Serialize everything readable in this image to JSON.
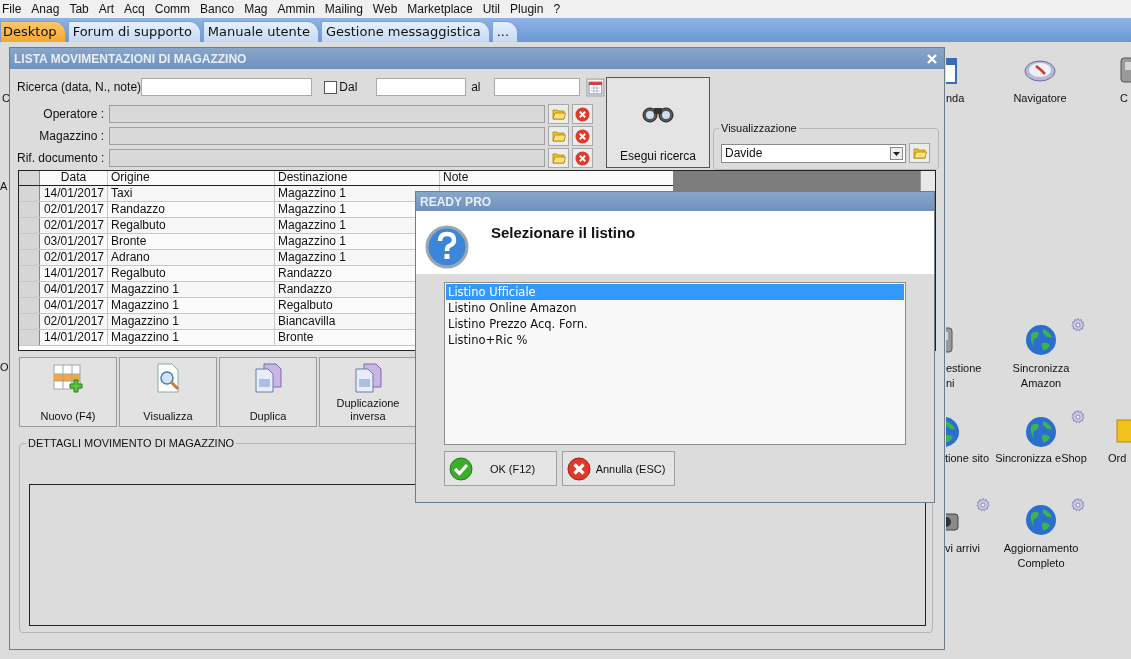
{
  "menu": [
    "File",
    "Anag",
    "Tab",
    "Art",
    "Acq",
    "Comm",
    "Banco",
    "Mag",
    "Ammin",
    "Mailing",
    "Web",
    "Marketplace",
    "Util",
    "Plugin",
    "?"
  ],
  "tabs": [
    {
      "label": "Desktop",
      "selected": true
    },
    {
      "label": "Forum di supporto",
      "selected": false
    },
    {
      "label": "Manuale utente",
      "selected": false
    },
    {
      "label": "Gestione messaggistica",
      "selected": false
    },
    {
      "label": "...",
      "selected": false
    }
  ],
  "desktop_icons": [
    {
      "lines": [
        "C"
      ],
      "kind": "none",
      "gear": false
    },
    {
      "lines": [
        "nda"
      ],
      "kind": "calendar",
      "gear": false
    },
    {
      "lines": [
        "Navigatore"
      ],
      "kind": "compass",
      "gear": false
    },
    {
      "lines": [
        "C"
      ],
      "kind": "device",
      "gear": false
    },
    {
      "lines": [
        "A"
      ],
      "kind": "none",
      "gear": false
    },
    {
      "lines": [
        "O"
      ],
      "kind": "none",
      "gear": false
    },
    {
      "lines": [
        "estione",
        "ni"
      ],
      "kind": "device",
      "gear": false
    },
    {
      "lines": [
        "Sincronizza",
        "Amazon"
      ],
      "kind": "globe",
      "gear": true
    },
    {
      "lines": [
        "tione sito"
      ],
      "kind": "globe",
      "gear": false
    },
    {
      "lines": [
        "Sincronizza eShop"
      ],
      "kind": "globe",
      "gear": true
    },
    {
      "lines": [
        "Ord"
      ],
      "kind": "folder",
      "gear": false
    },
    {
      "lines": [
        "vi arrivi"
      ],
      "kind": "camera",
      "gear": true
    },
    {
      "lines": [
        "Aggiornamento",
        "Completo"
      ],
      "kind": "globe",
      "gear": true
    }
  ],
  "window": {
    "title": "LISTA MOVIMENTAZIONI DI MAGAZZINO",
    "search": {
      "label": "Ricerca (data, N., note)",
      "date_from": {
        "label": "Dal",
        "checked": false
      },
      "date_to_label": "al"
    },
    "filters": [
      {
        "label": "Operatore :",
        "disabled": true
      },
      {
        "label": "Magazzino :",
        "disabled": true
      },
      {
        "label": "Rif. documento :",
        "disabled": true
      }
    ],
    "search_button": "Esegui ricerca",
    "view": {
      "label": "Visualizzazione",
      "value": "Davide"
    },
    "table": {
      "columns": [
        "Data",
        "Origine",
        "Destinazione",
        "Note"
      ],
      "rows": [
        {
          "data": "14/01/2017",
          "origine": "Taxi",
          "destinazione": "Magazzino 1"
        },
        {
          "data": "02/01/2017",
          "origine": "Randazzo",
          "destinazione": "Magazzino 1"
        },
        {
          "data": "02/01/2017",
          "origine": "Regalbuto",
          "destinazione": "Magazzino 1"
        },
        {
          "data": "03/01/2017",
          "origine": "Bronte",
          "destinazione": "Magazzino 1"
        },
        {
          "data": "02/01/2017",
          "origine": "Adrano",
          "destinazione": "Magazzino 1"
        },
        {
          "data": "14/01/2017",
          "origine": "Regalbuto",
          "destinazione": "Randazzo"
        },
        {
          "data": "04/01/2017",
          "origine": "Magazzino 1",
          "destinazione": "Randazzo"
        },
        {
          "data": "04/01/2017",
          "origine": "Magazzino 1",
          "destinazione": "Regalbuto"
        },
        {
          "data": "02/01/2017",
          "origine": "Magazzino 1",
          "destinazione": "Biancavilla"
        },
        {
          "data": "14/01/2017",
          "origine": "Magazzino 1",
          "destinazione": "Bronte"
        }
      ]
    },
    "actions": [
      {
        "label": "Nuovo (F4)",
        "kind": "new"
      },
      {
        "label": "Visualizza",
        "kind": "view"
      },
      {
        "label": "Duplica",
        "kind": "duplicate"
      },
      {
        "label": "Duplicazione inversa",
        "kind": "duplicate_inverse"
      }
    ],
    "details": {
      "title": "DETTAGLI MOVIMENTO DI MAGAZZINO"
    }
  },
  "dialog": {
    "title": "READY PRO",
    "heading": "Selezionare il listino",
    "options": [
      {
        "label": "Listino Ufficiale",
        "selected": true
      },
      {
        "label": "Listino Online Amazon",
        "selected": false
      },
      {
        "label": "Listino Prezzo Acq. Forn.",
        "selected": false
      },
      {
        "label": "Listino+Ric %",
        "selected": false
      }
    ],
    "buttons": [
      {
        "label": "OK (F12)",
        "kind": "ok"
      },
      {
        "label": "Annulla (ESC)",
        "kind": "cancel"
      }
    ]
  }
}
